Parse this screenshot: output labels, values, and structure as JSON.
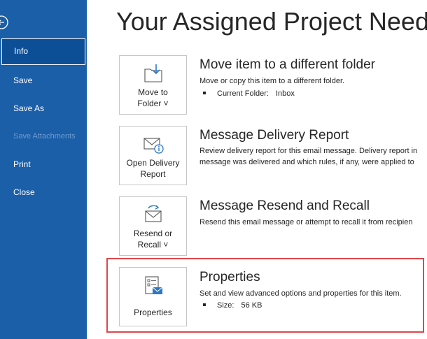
{
  "sidebar": {
    "items": [
      {
        "label": "Info"
      },
      {
        "label": "Save"
      },
      {
        "label": "Save As"
      },
      {
        "label": "Save Attachments"
      },
      {
        "label": "Print"
      },
      {
        "label": "Close"
      }
    ]
  },
  "main": {
    "title": "Your Assigned Project Needs",
    "sections": [
      {
        "button_line1": "Move to",
        "button_line2": "Folder ˅",
        "heading": "Move item to a different folder",
        "description": "Move or copy this item to a different folder.",
        "bullet_label": "Current Folder:",
        "bullet_value": "Inbox"
      },
      {
        "button_line1": "Open Delivery",
        "button_line2": "Report",
        "heading": "Message Delivery Report",
        "description_line1": "Review delivery report for this email message. Delivery report in",
        "description_line2": "message was delivered and which rules, if any, were applied to"
      },
      {
        "button_line1": "Resend or",
        "button_line2": "Recall ˅",
        "heading": "Message Resend and Recall",
        "description": "Resend this email message or attempt to recall it from recipien"
      },
      {
        "button_line1": "Properties",
        "heading": "Properties",
        "description": "Set and view advanced options and properties for this item.",
        "bullet_label": "Size:",
        "bullet_value": "56 KB"
      }
    ]
  },
  "colors": {
    "sidebar_bg": "#1b5fa8",
    "highlight": "#e0464c",
    "icon_blue": "#2b79c7"
  }
}
